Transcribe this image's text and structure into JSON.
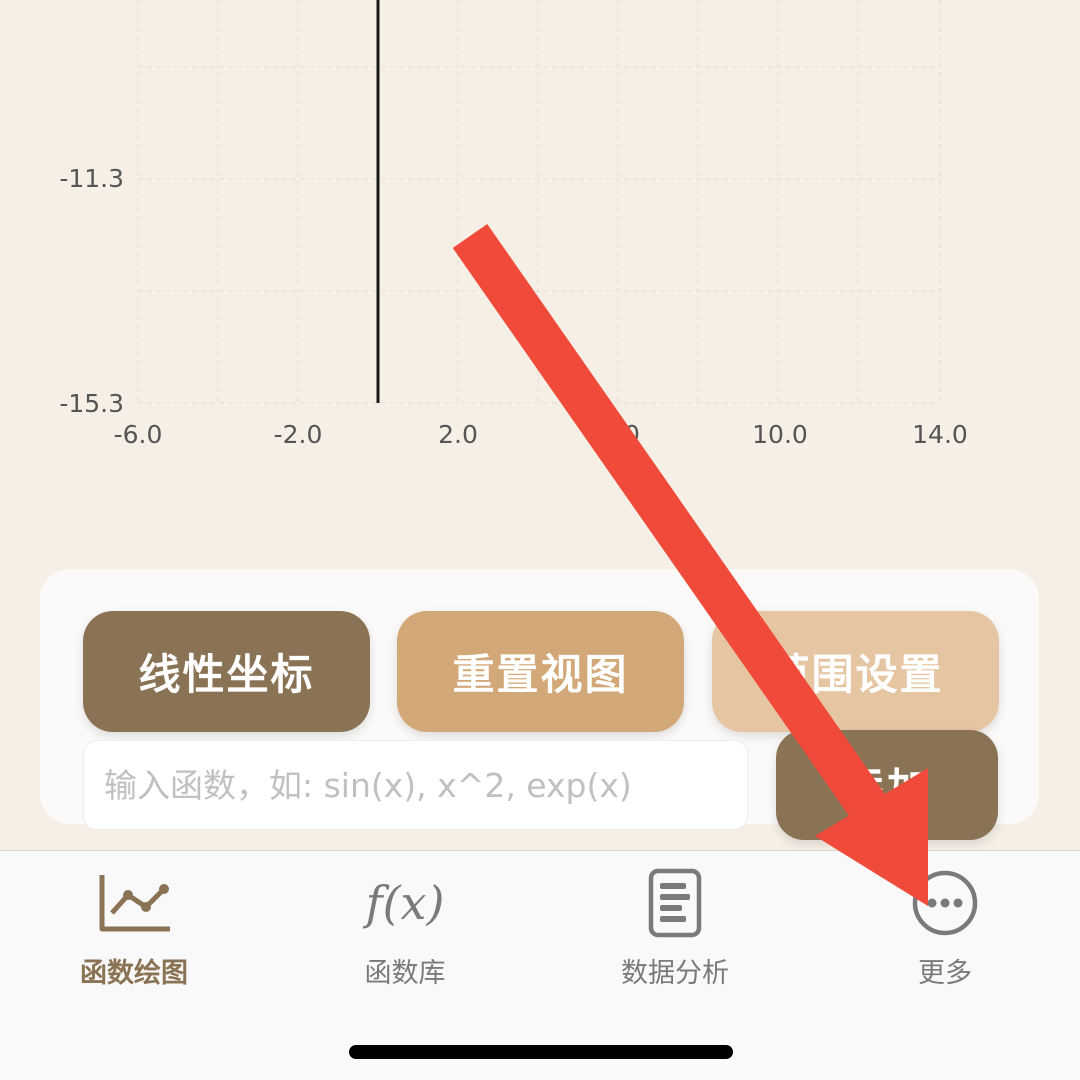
{
  "plot": {
    "y_ticks": [
      "-11.3",
      "-15.3"
    ],
    "x_ticks": [
      "-6.0",
      "-2.0",
      "2.0",
      "0",
      "10.0",
      "14.0"
    ],
    "line_color": "#1a1a1a",
    "grid_color": "#e9e1d5"
  },
  "controls": {
    "linear_label": "线性坐标",
    "reset_label": "重置视图",
    "range_label": "范围设置",
    "input_placeholder": "输入函数，如: sin(x), x^2, exp(x)",
    "input_value": "",
    "add_label": "添加"
  },
  "tabs": [
    {
      "label": "函数绘图",
      "icon": "line-chart-icon",
      "active": true
    },
    {
      "label": "函数库",
      "icon": "fx-icon",
      "glyph": "f(x)",
      "active": false
    },
    {
      "label": "数据分析",
      "icon": "document-icon",
      "active": false
    },
    {
      "label": "更多",
      "icon": "more-icon",
      "active": false
    }
  ],
  "colors": {
    "accent_dark": "#8a7354",
    "accent_mid": "#d2a878",
    "accent_light": "#e6c6a2",
    "arrow": "#f04a3a",
    "background": "#f5efe6"
  }
}
